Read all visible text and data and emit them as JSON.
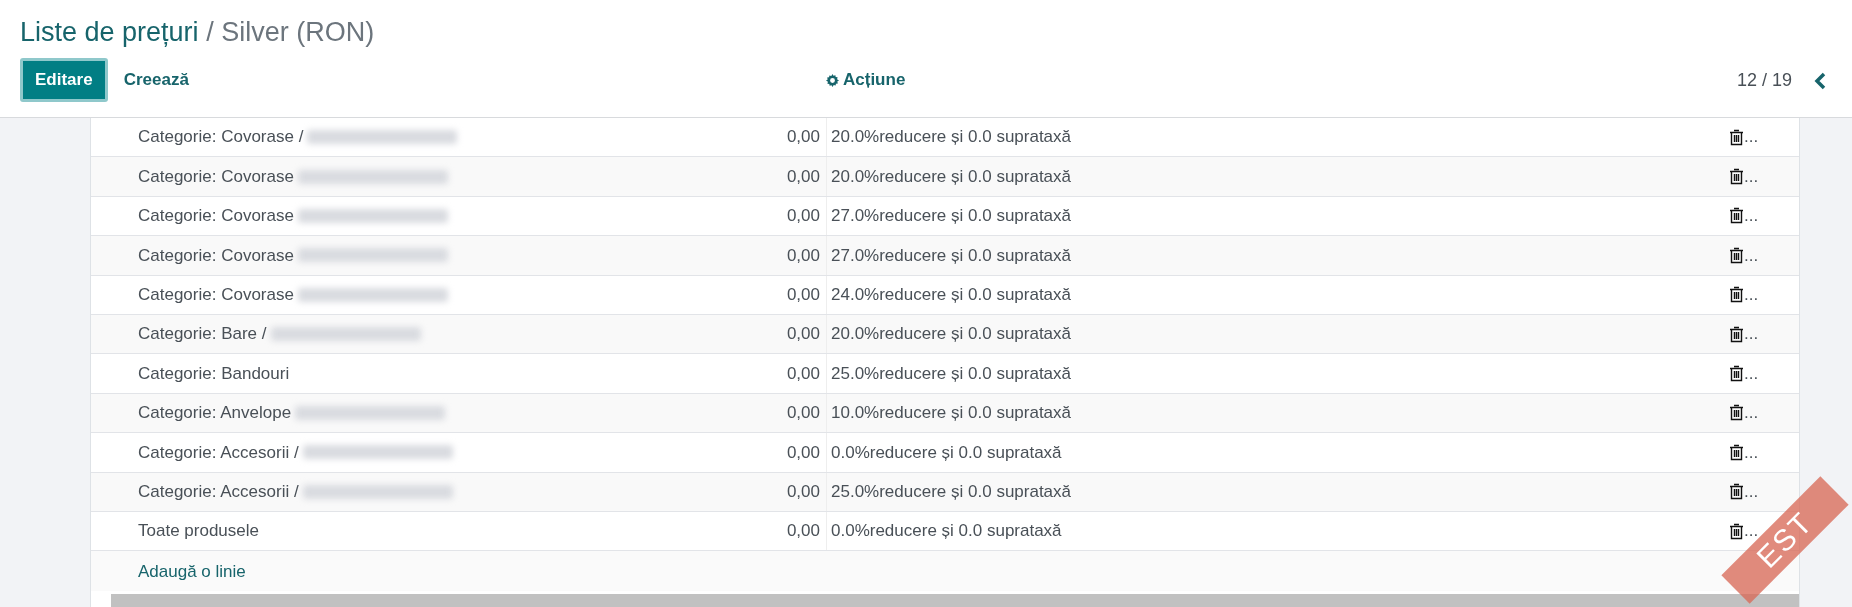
{
  "breadcrumb": {
    "parent": "Liste de prețuri",
    "separator": "/",
    "current": "Silver (RON)"
  },
  "toolbar": {
    "buttons": [
      {
        "label": "Editare",
        "kind": "primary"
      },
      {
        "label": "Creează",
        "kind": "link"
      }
    ],
    "action": "Acțiune",
    "pager": "12 / 19"
  },
  "rows": [
    {
      "name": "Categorie: Covorase /",
      "redacted": true,
      "price": "0,00",
      "rule": "20.0%reducere și 0.0 suprataxă",
      "more": "..."
    },
    {
      "name": "Categorie: Covorase",
      "redacted": true,
      "price": "0,00",
      "rule": "20.0%reducere și 0.0 suprataxă",
      "more": "..."
    },
    {
      "name": "Categorie: Covorase",
      "redacted": true,
      "price": "0,00",
      "rule": "27.0%reducere și 0.0 suprataxă",
      "more": "..."
    },
    {
      "name": "Categorie: Covorase",
      "redacted": true,
      "price": "0,00",
      "rule": "27.0%reducere și 0.0 suprataxă",
      "more": "..."
    },
    {
      "name": "Categorie: Covorase",
      "redacted": true,
      "price": "0,00",
      "rule": "24.0%reducere și 0.0 suprataxă",
      "more": "..."
    },
    {
      "name": "Categorie: Bare /",
      "redacted": true,
      "price": "0,00",
      "rule": "20.0%reducere și 0.0 suprataxă",
      "more": "..."
    },
    {
      "name": "Categorie: Bandouri",
      "redacted": false,
      "price": "0,00",
      "rule": "25.0%reducere și 0.0 suprataxă",
      "more": "..."
    },
    {
      "name": "Categorie: Anvelope",
      "redacted": true,
      "price": "0,00",
      "rule": "10.0%reducere și 0.0 suprataxă",
      "more": "..."
    },
    {
      "name": "Categorie: Accesorii /",
      "redacted": true,
      "price": "0,00",
      "rule": "0.0%reducere și 0.0 suprataxă",
      "more": "..."
    },
    {
      "name": "Categorie: Accesorii /",
      "redacted": true,
      "price": "0,00",
      "rule": "25.0%reducere și 0.0 suprataxă",
      "more": "..."
    },
    {
      "name": "Toate produsele",
      "redacted": false,
      "price": "0,00",
      "rule": "0.0%reducere și 0.0 suprataxă",
      "more": "..."
    }
  ],
  "add_line": "Adaugă o linie",
  "ribbon": "EST"
}
